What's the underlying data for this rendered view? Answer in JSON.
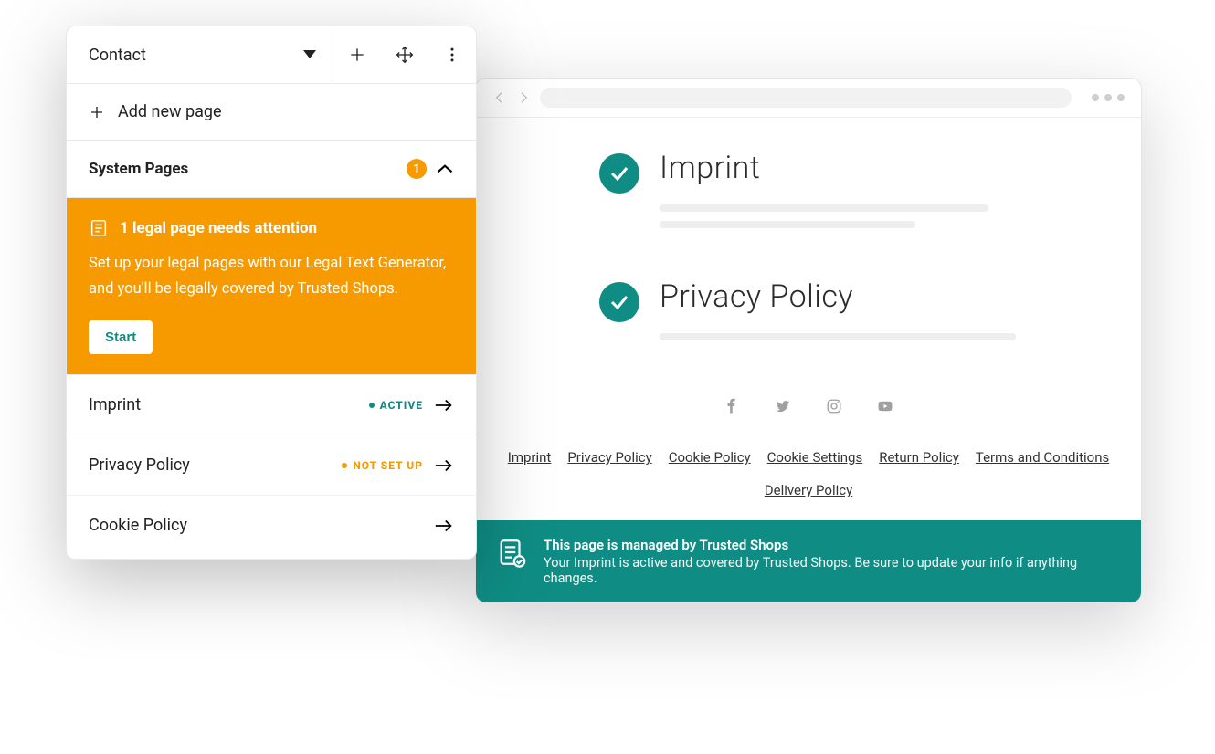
{
  "sidebar": {
    "title": "Contact",
    "add_label": "Add new page",
    "system_label": "System Pages",
    "badge_count": "1",
    "attention": {
      "title": "1 legal page needs attention",
      "desc": "Set up your legal pages with our Legal Text Generator, and you'll be legally covered by Trusted Shops.",
      "button": "Start"
    },
    "pages": [
      {
        "name": "Imprint",
        "status_label": "ACTIVE",
        "status_kind": "active"
      },
      {
        "name": "Privacy Policy",
        "status_label": "NOT SET UP",
        "status_kind": "notset"
      },
      {
        "name": "Cookie Policy",
        "status_label": "",
        "status_kind": ""
      }
    ]
  },
  "preview": {
    "items": [
      {
        "title": "Imprint"
      },
      {
        "title": "Privacy Policy"
      }
    ],
    "footer_links": [
      "Imprint",
      "Privacy Policy",
      "Cookie Policy",
      "Cookie Settings",
      "Return Policy",
      "Terms and Conditions",
      "Delivery Policy"
    ],
    "trusted": {
      "title": "This page is managed by Trusted Shops",
      "desc": "Your Imprint is active and covered by Trusted Shops. Be sure to update your info if anything changes."
    }
  }
}
